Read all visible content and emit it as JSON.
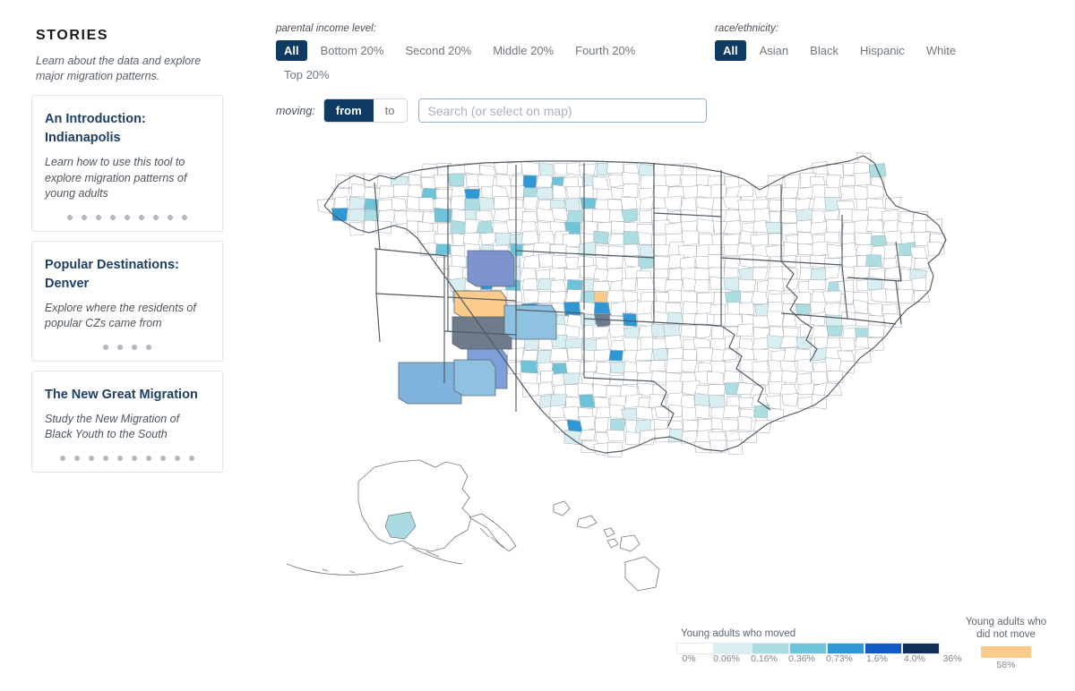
{
  "sidebar": {
    "title": "STORIES",
    "subtitle": "Learn about the data and explore major migration patterns.",
    "stories": [
      {
        "title": "An Introduction: Indianapolis",
        "description": "Learn how to use this tool to explore migration patterns of young adults",
        "steps": 9
      },
      {
        "title": "Popular Destinations: Denver",
        "description": "Explore where the residents of popular CZs came from",
        "steps": 4
      },
      {
        "title": "The New Great Migration",
        "description": "Study the New Migration of Black Youth to the South",
        "steps": 10
      }
    ]
  },
  "filters": {
    "income": {
      "label": "parental income level:",
      "options": [
        "All",
        "Bottom 20%",
        "Second 20%",
        "Middle 20%",
        "Fourth 20%",
        "Top 20%"
      ],
      "selected": "All"
    },
    "race": {
      "label": "race/ethnicity:",
      "options": [
        "All",
        "Asian",
        "Black",
        "Hispanic",
        "White"
      ],
      "selected": "All"
    },
    "moving": {
      "label": "moving:",
      "options": [
        "from",
        "to"
      ],
      "selected": "from"
    },
    "search": {
      "placeholder": "Search (or select on map)",
      "value": ""
    }
  },
  "legend": {
    "moved_title": "Young adults who moved",
    "stay_title_line1": "Young adults who",
    "stay_title_line2": "did not move",
    "stay_value": "58%",
    "stay_color": "#fbcb8c",
    "ticks": [
      "0%",
      "0.06%",
      "0.16%",
      "0.36%",
      "0.73%",
      "1.6%",
      "4.0%",
      "36%"
    ],
    "colors": [
      "#ffffff",
      "#d9eef0",
      "#abdde1",
      "#6ec3d9",
      "#2f97d4",
      "#1259c4",
      "#0e2f56"
    ]
  },
  "theme": {
    "accent_navy": "#0f3a63",
    "story_title_blue": "#1d3f66",
    "selected_cz_color": "#fbcb8c",
    "hover_cz_color": "#6e7b8b",
    "map_stroke": "#9aa3ad",
    "state_stroke": "#4f5962"
  },
  "chart_data": {
    "type": "heatmap",
    "title": "Young adults who moved",
    "description": "US commuting-zone choropleth of young adult out-migration from a selected Utah commuting zone",
    "legend_bins": [
      "0%",
      "0.06%",
      "0.16%",
      "0.36%",
      "0.73%",
      "1.6%",
      "4.0%",
      "36%"
    ],
    "bin_colors": [
      "#ffffff",
      "#d9eef0",
      "#abdde1",
      "#6ec3d9",
      "#2f97d4",
      "#1259c4",
      "#0e2f56"
    ],
    "did_not_move_pct": "58%",
    "highlight_regions": [
      {
        "name": "selected-cz",
        "color": "#fbcb8c",
        "label": "origin commuting zone"
      },
      {
        "name": "hovered-cz",
        "color": "#6e7b8b",
        "label": "hovered commuting zone"
      }
    ]
  }
}
